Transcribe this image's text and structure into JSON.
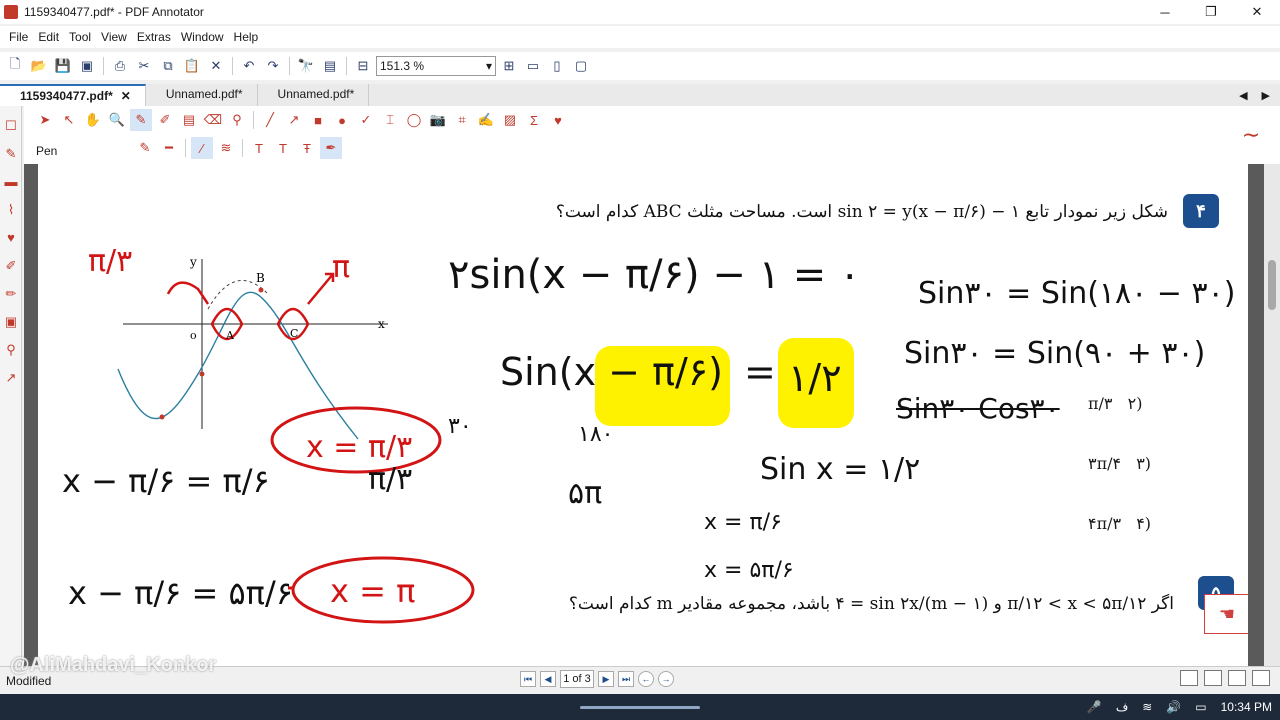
{
  "window": {
    "title": "1159340477.pdf* - PDF Annotator",
    "minimize": "─",
    "maximize": "❐",
    "close": "✕"
  },
  "menu": [
    "File",
    "Edit",
    "Tool",
    "View",
    "Extras",
    "Window",
    "Help"
  ],
  "toolbar": {
    "zoom_value": "151.3 %"
  },
  "tabs": [
    {
      "label": "1159340477.pdf*",
      "active": true,
      "close": "✕"
    },
    {
      "label": "Unnamed.pdf*",
      "active": false
    },
    {
      "label": "Unnamed.pdf*",
      "active": false
    }
  ],
  "annotation_toolbar": {
    "tool_label": "Pen"
  },
  "question4": {
    "number": "۴",
    "text": "شکل زیر نمودار تابع ۱ − (x − π/۶)sin ۲ = y است. مساحت مثلث ABC کدام است؟",
    "options": [
      {
        "num": "(۲",
        "value": "π/۳"
      },
      {
        "num": "(۳",
        "value": "۳π/۴"
      },
      {
        "num": "(۴",
        "value": "۴π/۳"
      }
    ],
    "graph_labels": {
      "y": "y",
      "x": "x",
      "b": "B",
      "a": "A",
      "c": "C",
      "o": "o"
    }
  },
  "question5": {
    "number": "۵",
    "text": "اگر π/۱۲ < x < ۵π/۱۲ و (m − ۱)/۴ = sin ۲x باشد، مجموعه مقادیر m کدام است؟"
  },
  "handwriting": {
    "eq1": "۲sin(x − π/۶) − ۱ = ۰",
    "eq2_left": "Sin(x − π/۶)",
    "eq2_eq": "=",
    "eq2_right": "۱/۲",
    "eq3": "Sin۳۰ = Sin(۱۸۰ − ۳۰)",
    "eq4": "Sin۳۰ = Sin(۹۰ + ۳۰)",
    "eq5": "Sin۳۰ Cos۳۰",
    "sinx": "Sin x = ۱/۲",
    "x1": "x = π/۶",
    "x2": "x = ۵π/۶",
    "line1": "x − π/۶ = π/۶",
    "line1_result": "x = π/۳",
    "line2": "x − π/۶ = ۵π/۶",
    "line2_result": "x = π",
    "note_deg": "۱۸۰",
    "note_5pi": "۵π",
    "note_pi3": "π/۳",
    "red_pi3": "π/۳",
    "red_pi": "π",
    "note30": "۳۰"
  },
  "status": {
    "left": "Modified",
    "watermark": "@AliMahdavi_Konkor",
    "page": "1 of 3",
    "time": "10:34 PM"
  }
}
